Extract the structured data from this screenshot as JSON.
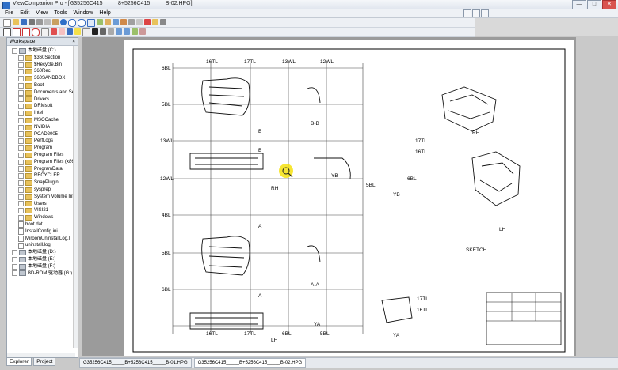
{
  "window": {
    "title": "ViewCompanion Pro - [G35256C415_____8+5256C415_____B-02.HPG]",
    "min_label": "—",
    "max_label": "□",
    "close_label": "✕"
  },
  "menu": [
    "File",
    "Edit",
    "View",
    "Tools",
    "Window",
    "Help"
  ],
  "workspace": {
    "title": "Workspace",
    "close_label": "×",
    "tree": [
      {
        "label": "本地磁盘 (C:)",
        "type": "drive"
      },
      {
        "label": "$360Section",
        "type": "folder"
      },
      {
        "label": "$Recycle.Bin",
        "type": "folder"
      },
      {
        "label": "360Rec",
        "type": "folder"
      },
      {
        "label": "360SANDBOX",
        "type": "folder"
      },
      {
        "label": "Boot",
        "type": "folder"
      },
      {
        "label": "Documents and Set",
        "type": "folder"
      },
      {
        "label": "Drivers",
        "type": "folder"
      },
      {
        "label": "DRMsoft",
        "type": "folder"
      },
      {
        "label": "Intel",
        "type": "folder"
      },
      {
        "label": "MSOCache",
        "type": "folder"
      },
      {
        "label": "NVIDIA",
        "type": "folder"
      },
      {
        "label": "PCAD2005",
        "type": "folder"
      },
      {
        "label": "PerfLogs",
        "type": "folder"
      },
      {
        "label": "Program",
        "type": "folder"
      },
      {
        "label": "Program Files",
        "type": "folder"
      },
      {
        "label": "Program Files (x86)",
        "type": "folder"
      },
      {
        "label": "ProgramData",
        "type": "folder"
      },
      {
        "label": "RECYCLER",
        "type": "folder"
      },
      {
        "label": "SnapPlugin",
        "type": "folder"
      },
      {
        "label": "sysprep",
        "type": "folder"
      },
      {
        "label": "System Volume Infc",
        "type": "folder"
      },
      {
        "label": "Users",
        "type": "folder"
      },
      {
        "label": "VISI21",
        "type": "folder"
      },
      {
        "label": "Windows",
        "type": "folder"
      },
      {
        "label": "boot.dat",
        "type": "file"
      },
      {
        "label": "InstallConfig.ini",
        "type": "file"
      },
      {
        "label": "MiroomUninstallLog.l",
        "type": "file"
      },
      {
        "label": "uninstall.log",
        "type": "file"
      },
      {
        "label": "本地磁盘 (D:)",
        "type": "drive"
      },
      {
        "label": "本地磁盘 (E:)",
        "type": "drive"
      },
      {
        "label": "本地磁盘 (F:)",
        "type": "drive"
      },
      {
        "label": "BD-ROM 驱动器 (G:)",
        "type": "drive"
      }
    ]
  },
  "pane_tabs": {
    "explorer": "Explorer",
    "project": "Project"
  },
  "doc_tabs": [
    "G35256C415_____B+5256C415_____B-01.HPG",
    "G35256C415_____B+5256C415_____B-02.HPG"
  ],
  "drawing": {
    "col_labels_top": [
      "16TL",
      "17TL",
      "13WL",
      "12WL"
    ],
    "col_labels_bottom": [
      "16TL",
      "17TL",
      "6BL",
      "5BL"
    ],
    "row_labels": [
      "6BL",
      "5BL",
      "13WL",
      "12WL",
      "4BL",
      "5BL",
      "6BL"
    ],
    "view_labels": [
      "B-B",
      "RH",
      "YB",
      "A-A",
      "YA",
      "LH",
      "RH",
      "LH",
      "SKETCH",
      "YB",
      "YA"
    ],
    "detail_labels": [
      "17TL",
      "16TL",
      "6BL",
      "5BL",
      "17TL",
      "16TL"
    ],
    "section_marks": [
      "B",
      "B",
      "A",
      "A"
    ]
  }
}
